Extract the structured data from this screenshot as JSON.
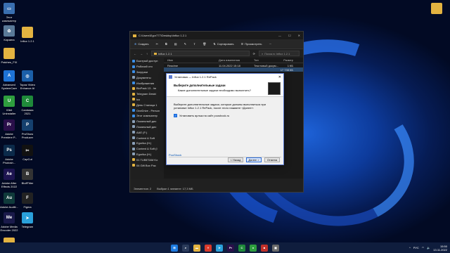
{
  "desktop": {
    "icons": [
      {
        "label": "Этот компьютер",
        "icon": "computer-icon",
        "color": "#3a6fb0",
        "glyph": "▭"
      },
      {
        "label": "Корзина",
        "icon": "recycle-bin-icon",
        "color": "#5a7a99",
        "glyph": "♻"
      },
      {
        "label": "Patches_FIX",
        "icon": "folder-icon",
        "color": "#e3b341",
        "glyph": ""
      },
      {
        "label": "Advanced SystemCare",
        "icon": "advanced-systemcare-icon",
        "color": "#1e73d6",
        "glyph": "A"
      },
      {
        "label": "IObit Uninstaller",
        "icon": "iobit-uninstaller-icon",
        "color": "#2e9e3e",
        "glyph": "U"
      },
      {
        "label": "Adobe Premiere P...",
        "icon": "premiere-icon",
        "color": "#2a0f4a",
        "glyph": "Pr"
      },
      {
        "label": "Adobe Photosh...",
        "icon": "photoshop-icon",
        "color": "#0b2a4a",
        "glyph": "Ps"
      },
      {
        "label": "Adobe After Effects 2022",
        "icon": "after-effects-icon",
        "color": "#1d1450",
        "glyph": "Ae"
      },
      {
        "label": "Adobe Auditi...",
        "icon": "audition-icon",
        "color": "#0f3a3a",
        "glyph": "Au"
      },
      {
        "label": "Adobe Media Encoder 2022",
        "icon": "media-encoder-icon",
        "color": "#1a1a4a",
        "glyph": "Me"
      },
      {
        "label": "Influx 1.2.1",
        "icon": "folder-icon",
        "color": "#e3b341",
        "glyph": ""
      },
      {
        "label": "Topaz Video Enhance AI",
        "icon": "topaz-icon",
        "color": "#1b5fa8",
        "glyph": "◎"
      },
      {
        "label": "Camtasia 2021",
        "icon": "camtasia-icon",
        "color": "#1f8a3a",
        "glyph": "C"
      },
      {
        "label": "ProShow Producer",
        "icon": "proshow-icon",
        "color": "#15406e",
        "glyph": "P"
      },
      {
        "label": "CapCut",
        "icon": "capcut-icon",
        "color": "#111111",
        "glyph": "✂"
      },
      {
        "label": "BluffTitler",
        "icon": "blufftitler-icon",
        "color": "#333333",
        "glyph": "B"
      },
      {
        "label": "Figma",
        "icon": "figma-icon",
        "color": "#222222",
        "glyph": "F"
      },
      {
        "label": "Telegram",
        "icon": "telegram-icon",
        "color": "#2aa0da",
        "glyph": "➤"
      },
      {
        "label": "",
        "icon": "folder-icon",
        "color": "#e3b341",
        "glyph": ""
      }
    ]
  },
  "explorer": {
    "title": "C:\\Users\\Egor777\\Desktop\\Influx 1.2.1",
    "toolbar": {
      "create": "Создать",
      "sort": "Сортировать",
      "view": "Просмотреть"
    },
    "address": "Influx 1.2.1",
    "search_placeholder": "Поиск в: Influx 1.2.1",
    "nav_items": [
      {
        "label": "Быстрый доступ",
        "color": "#3a8ee6"
      },
      {
        "label": "Рабочий сто",
        "color": "#3a8ee6"
      },
      {
        "label": "Загрузки",
        "color": "#3a8ee6"
      },
      {
        "label": "Документы",
        "color": "#8aa0b8"
      },
      {
        "label": "Изображения",
        "color": "#3a8ee6"
      },
      {
        "label": "BioPack 13 - Im",
        "color": "#e3b341"
      },
      {
        "label": "Telegram Deskt",
        "color": "#e3b341"
      },
      {
        "label": "ico",
        "color": "#e3b341"
      },
      {
        "label": "День Станица 1",
        "color": "#e3b341"
      },
      {
        "label": "OneDrive - Person",
        "color": "#3a8ee6"
      },
      {
        "label": "Этот компьютер",
        "color": "#3a8ee6"
      },
      {
        "label": "Локальный дис",
        "color": "#8aa0b8"
      },
      {
        "label": "Локальный дис",
        "color": "#8aa0b8"
      },
      {
        "label": "AAE (F:)",
        "color": "#8aa0b8"
      },
      {
        "label": "Content & Soft",
        "color": "#8aa0b8"
      },
      {
        "label": "Egorika (H:)",
        "color": "#8aa0b8"
      },
      {
        "label": "Content & Soft (I",
        "color": "#8aa0b8"
      },
      {
        "label": "Egorika (H:)",
        "color": "#8aa0b8"
      },
      {
        "label": "01 TUBETAM Ko",
        "color": "#e3b341"
      },
      {
        "label": "04 Gift Box Pac",
        "color": "#e3b341"
      }
    ],
    "columns": [
      "Имя",
      "Дата изменения",
      "Тип",
      "Размер"
    ],
    "rows": [
      {
        "name": "Readme",
        "date": "11.04.2022 15:18",
        "type": "Текстовый докум...",
        "size": "1 КБ"
      },
      {
        "name": "",
        "date": "",
        "type": "",
        "size": "17 738 КБ"
      }
    ],
    "status": {
      "count": "Элементов: 2",
      "selected": "Выбран 1 элемент: 17,3 МБ"
    }
  },
  "dialog": {
    "title": "Установка — Influx 1.2.1 RePack",
    "heading": "Выберите дополнительные задачи",
    "subheading": "Какие дополнительные задачи необходимо выполнить?",
    "text": "Выберите дополнительные задачи, которые должны выполниться при установке Influx 1.2.1 RePack, после этого нажмите «Далее»:",
    "checkbox_label": "Установить ярлык на сайт pooshock.ru",
    "checkbox_checked": true,
    "footer_link": "PooShock",
    "back": "< Назад",
    "next": "Далее >",
    "cancel": "Отмена"
  },
  "taskbar": {
    "apps": [
      {
        "icon": "windows-start-icon",
        "color": "#1e7be0",
        "glyph": "⊞"
      },
      {
        "icon": "search-icon",
        "color": "#2b3b5b",
        "glyph": "⌕"
      },
      {
        "icon": "file-explorer-icon",
        "color": "#e3b341",
        "glyph": "▬"
      },
      {
        "icon": "yandex-browser-icon",
        "color": "#d93a2b",
        "glyph": "Y"
      },
      {
        "icon": "telegram-icon",
        "color": "#2aa0da",
        "glyph": "➤"
      },
      {
        "icon": "premiere-icon",
        "color": "#2a0f4a",
        "glyph": "Pr"
      },
      {
        "icon": "camtasia-icon",
        "color": "#1f8a3a",
        "glyph": "C"
      },
      {
        "icon": "recorder-icon",
        "color": "#2e9e3e",
        "glyph": "●"
      },
      {
        "icon": "red-app-icon",
        "color": "#c0302a",
        "glyph": "■"
      },
      {
        "icon": "installer-icon",
        "color": "#6a6a6a",
        "glyph": "▣"
      }
    ],
    "lang": "РУС",
    "time": "15:50",
    "date": "13.11.2022"
  }
}
